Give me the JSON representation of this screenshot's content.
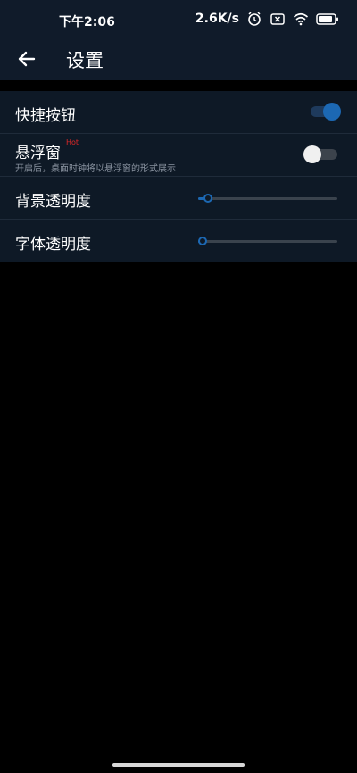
{
  "status_bar": {
    "time": "下午2:06",
    "network_speed": "2.6K/s",
    "icons": [
      "alarm-icon",
      "sim-error-icon",
      "wifi-icon",
      "battery-icon"
    ]
  },
  "app_bar": {
    "back_icon": "arrow-left-icon",
    "title": "设置"
  },
  "settings": {
    "shortcut_button": {
      "label": "快捷按钮",
      "enabled": true
    },
    "floating_window": {
      "label": "悬浮窗",
      "badge": "Hot",
      "description": "开启后，桌面时钟将以悬浮窗的形式展示",
      "enabled": false
    },
    "background_opacity": {
      "label": "背景透明度",
      "value_fraction": 0.04
    },
    "font_opacity": {
      "label": "字体透明度",
      "value_fraction": 0.0
    }
  },
  "colors": {
    "accent": "#1c68b3",
    "badge": "#e02828",
    "panel_bg": "#0e1926",
    "header_bg": "#101b2a"
  }
}
